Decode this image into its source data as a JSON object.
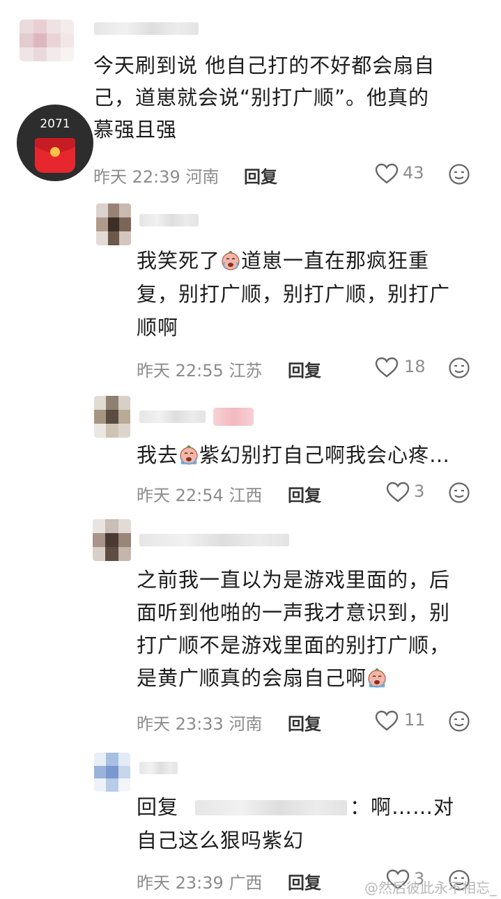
{
  "comments": [
    {
      "text": "今天刷到说 他自己打的不好都会扇自己，道崽就会说“别打广顺”。他真的慕强且强",
      "line1": "今天刷到说 他自己打的不好都会扇自",
      "line2": "己，道崽就会说“别打广顺”。他真的",
      "line3": "慕强且强",
      "time": "昨天 22:39",
      "location": "河南",
      "reply_label": "回复",
      "likes": "43",
      "badge_number": "2071"
    },
    {
      "line1_a": "我笑死了",
      "line1_b": "道崽一直在那疯狂重",
      "line2": "复，别打广顺，别打广顺，别打广",
      "line3": "顺啊",
      "time": "昨天 22:55",
      "location": "江苏",
      "reply_label": "回复",
      "likes": "18"
    },
    {
      "line1_a": "我去",
      "line1_b": "紫幻别打自己啊我会心疼…",
      "time": "昨天 22:54",
      "location": "江西",
      "reply_label": "回复",
      "likes": "3"
    },
    {
      "line1": "之前我一直以为是游戏里面的，后",
      "line2": "面听到他啪的一声我才意识到，别",
      "line3": "打广顺不是游戏里面的别打广顺，",
      "line4": "是黄广顺真的会扇自己啊",
      "time": "昨天 23:33",
      "location": "河南",
      "reply_label": "回复",
      "likes": "11"
    },
    {
      "line1_prefix": "回复",
      "line1_suffix": "：啊……对",
      "line2": "自己这么狠吗紫幻",
      "time": "昨天 23:39",
      "location": "广西",
      "reply_label": "回复",
      "likes": "3"
    }
  ],
  "icons": {
    "like": "heart-outline-icon",
    "emoji": "smiley-face-icon",
    "inline_emoji": "crying-laugh-emoji"
  },
  "colors": {
    "text": "#1c1c1c",
    "meta": "#8c8c8c",
    "badge_bg": "#2d2d2d",
    "red_packet": "#e8262e"
  },
  "watermark": "@然后彼此永不相忘_"
}
